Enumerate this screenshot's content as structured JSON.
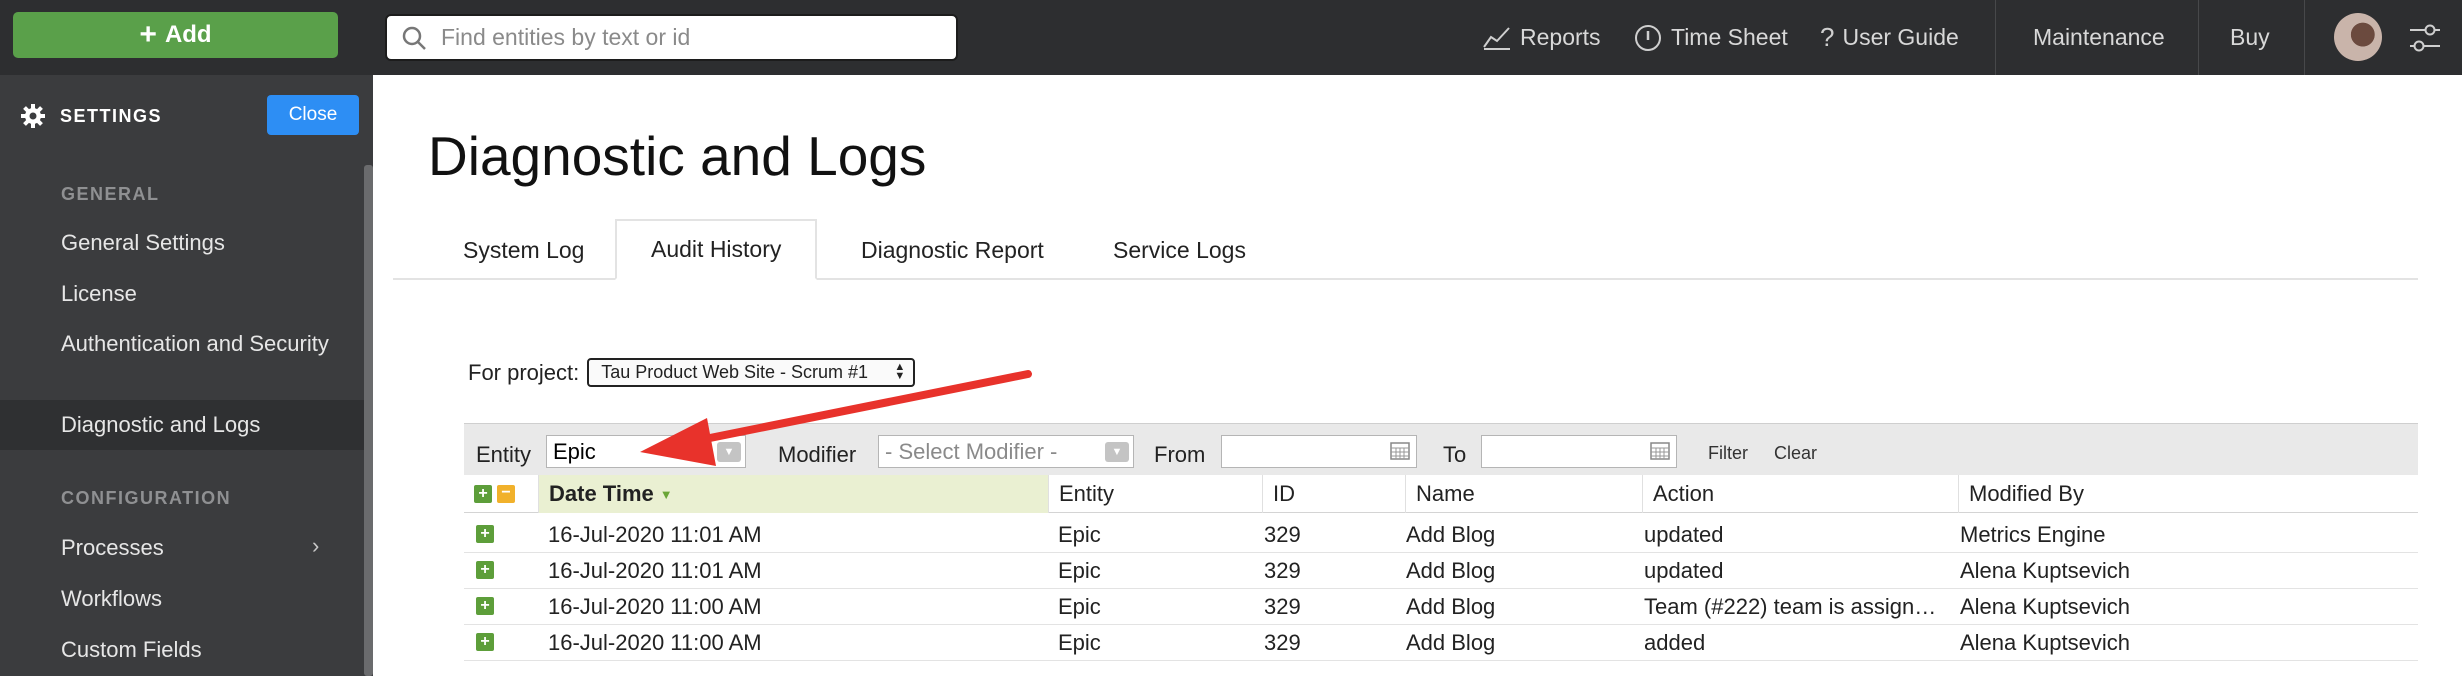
{
  "topbar": {
    "add_label": "Add",
    "search_placeholder": "Find entities by text or id",
    "nav": {
      "reports": "Reports",
      "timesheet": "Time Sheet",
      "userguide": "User Guide",
      "maintenance": "Maintenance",
      "buy": "Buy"
    }
  },
  "sidebar": {
    "header": "SETTINGS",
    "close_label": "Close",
    "section_general": "GENERAL",
    "items_general": [
      "General Settings",
      "License",
      "Authentication and Security",
      "Diagnostic and Logs"
    ],
    "section_config": "CONFIGURATION",
    "items_config": [
      "Processes",
      "Workflows",
      "Custom Fields"
    ]
  },
  "page": {
    "title": "Diagnostic and Logs",
    "tabs": [
      "System Log",
      "Audit History",
      "Diagnostic Report",
      "Service Logs"
    ],
    "active_tab": "Audit History"
  },
  "project": {
    "label": "For project:",
    "selected": "Tau Product Web Site - Scrum #1"
  },
  "filter": {
    "entity_label": "Entity",
    "entity_value": "Epic",
    "modifier_label": "Modifier",
    "modifier_placeholder": "- Select Modifier -",
    "from_label": "From",
    "to_label": "To",
    "filter_link": "Filter",
    "clear_link": "Clear"
  },
  "table": {
    "columns": [
      "Date Time",
      "Entity",
      "ID",
      "Name",
      "Action",
      "Modified By"
    ],
    "rows": [
      [
        "16-Jul-2020 11:01 AM",
        "Epic",
        "329",
        "Add Blog",
        "updated",
        "Metrics Engine"
      ],
      [
        "16-Jul-2020 11:01 AM",
        "Epic",
        "329",
        "Add Blog",
        "updated",
        "Alena Kuptsevich"
      ],
      [
        "16-Jul-2020 11:00 AM",
        "Epic",
        "329",
        "Add Blog",
        "Team (#222) team is assign…",
        "Alena Kuptsevich"
      ],
      [
        "16-Jul-2020 11:00 AM",
        "Epic",
        "329",
        "Add Blog",
        "added",
        "Alena Kuptsevich"
      ]
    ]
  },
  "colors": {
    "topbar": "#2d2e30",
    "sidebar": "#3b3c3e",
    "add_button": "#5aa04a",
    "close_button": "#2d8ef4",
    "annotation_arrow": "#e8322b"
  }
}
